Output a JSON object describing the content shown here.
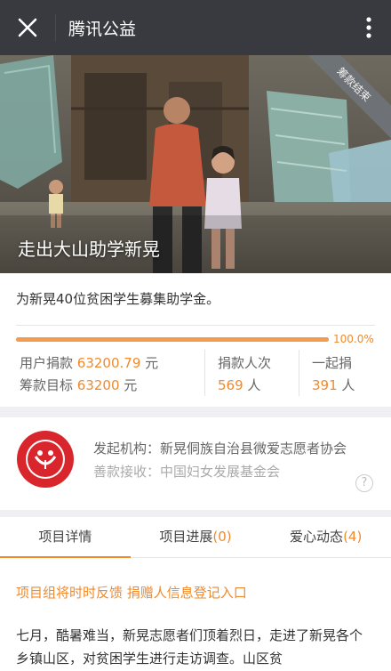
{
  "topbar": {
    "title": "腾讯公益",
    "close_icon": "close-icon",
    "more_icon": "more-vertical-icon"
  },
  "banner": {
    "title": "走出大山助学新晃",
    "ribbon": "筹款结束"
  },
  "project": {
    "description": "为新晃40位贫困学生募集助学金。",
    "progress": 1.0,
    "progress_label": "100.0%",
    "donated_label": "用户捐款",
    "donated_value": "63200.79",
    "unit_yuan": "元",
    "goal_label": "筹款目标",
    "goal_value": "63200",
    "donations_label": "捐款人次",
    "donations_value": "569",
    "unit_person": "人",
    "together_label": "一起捐",
    "together_value": "391"
  },
  "organizer": {
    "initiator": "发起机构：新晃侗族自治县微爱志愿者协会",
    "receiver": "善款接收：中国妇女发展基金会",
    "help": "?"
  },
  "tabs": [
    {
      "label": "项目详情",
      "count": ""
    },
    {
      "label": "项目进展",
      "count": "(0)"
    },
    {
      "label": "爱心动态",
      "count": "(4)"
    }
  ],
  "content": {
    "link": "项目组将时时反馈 捐赠人信息登记入口",
    "paragraph": "七月，酷暑难当，新晃志愿者们顶着烈日，走进了新晃各个乡镇山区，对贫困学生进行走访调查。山区贫"
  },
  "colors": {
    "accent": "#f08a2c",
    "topbar": "#393a3f"
  }
}
